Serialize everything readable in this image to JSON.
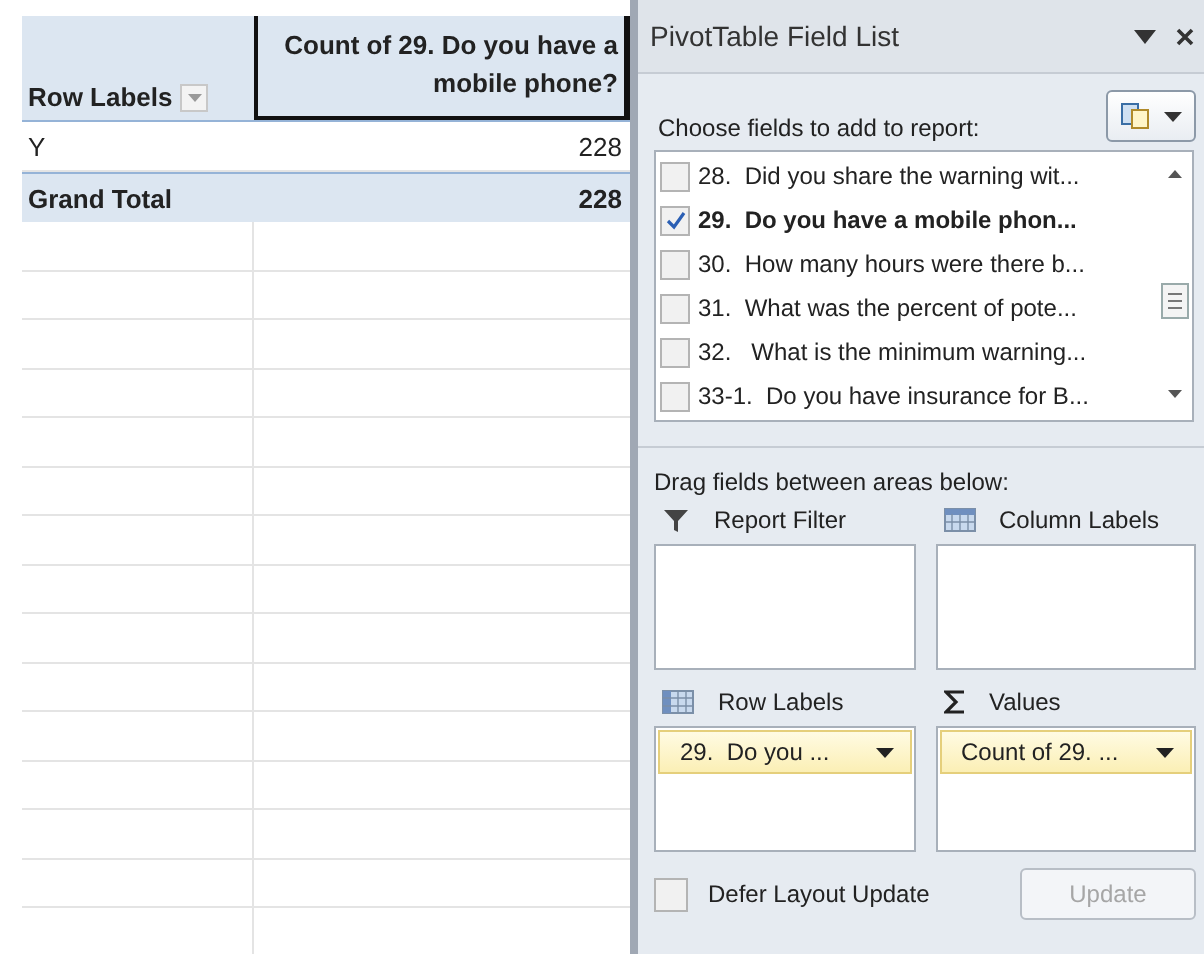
{
  "pivot_table": {
    "header": {
      "row_labels": "Row Labels",
      "values": "Count of 29.  Do you have a mobile phone?"
    },
    "rows": [
      {
        "label": "Y",
        "value": "228",
        "kind": "item"
      },
      {
        "label": "Grand Total",
        "value": "228",
        "kind": "total"
      }
    ]
  },
  "field_list": {
    "title": "PivotTable Field List",
    "choose_label": "Choose fields to add to report:",
    "fields": [
      {
        "label": "28.  Did you share the warning wit...",
        "checked": false
      },
      {
        "label": "29.  Do you have a mobile phon...",
        "checked": true
      },
      {
        "label": "30.  How many hours were there b...",
        "checked": false
      },
      {
        "label": "31.  What was the percent of pote...",
        "checked": false
      },
      {
        "label": "32.   What is the minimum warning...",
        "checked": false
      },
      {
        "label": "33-1.  Do you have insurance for B...",
        "checked": false
      }
    ],
    "drag_label": "Drag fields between areas below:",
    "areas": [
      {
        "kind": "filter",
        "label": "Report Filter"
      },
      {
        "kind": "columns",
        "label": "Column Labels"
      },
      {
        "kind": "rows",
        "label": "Row Labels",
        "items": [
          "29.  Do you ..."
        ]
      },
      {
        "kind": "values",
        "label": "Values",
        "items": [
          "Count of 29. ..."
        ]
      }
    ],
    "defer": {
      "label": "Defer Layout Update",
      "checked": false
    },
    "update_button": {
      "label": "Update",
      "disabled": true
    }
  }
}
